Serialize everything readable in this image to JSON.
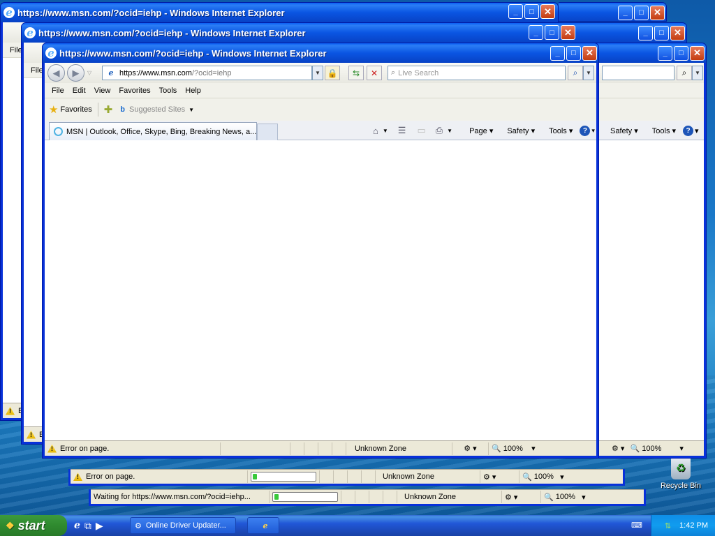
{
  "windows": [
    {
      "title": "https://www.msn.com/?ocid=iehp - Windows Internet Explorer"
    },
    {
      "title": "https://www.msn.com/?ocid=iehp - Windows Internet Explorer"
    },
    {
      "title": "https://www.msn.com/?ocid=iehp - Windows Internet Explorer"
    }
  ],
  "front": {
    "address_scheme": "https://",
    "address_host": "www.msn.com",
    "address_path": "/?ocid=iehp",
    "search_placeholder": "Live Search",
    "menu": [
      "File",
      "Edit",
      "View",
      "Favorites",
      "Tools",
      "Help"
    ],
    "favorites_label": "Favorites",
    "suggested_sites": "Suggested Sites",
    "tab_title": "MSN | Outlook, Office, Skype, Bing, Breaking News, a...",
    "commands": {
      "page": "Page",
      "safety": "Safety",
      "tools": "Tools"
    },
    "status_text": "Error on page.",
    "zone": "Unknown Zone",
    "zoom": "100%"
  },
  "back_windows": {
    "partial_menu": "File",
    "commands": {
      "safety": "Safety",
      "tools": "Tools"
    },
    "zoom": "100%",
    "partial_status": "E"
  },
  "status_bar_2": {
    "text": "Error on page.",
    "zone": "Unknown Zone",
    "zoom": "100%",
    "progress": 0.05
  },
  "status_bar_3": {
    "text": "Waiting for https://www.msn.com/?ocid=iehp...",
    "zone": "Unknown Zone",
    "zoom": "100%",
    "progress": 0.05
  },
  "taskbar": {
    "start_label": "start",
    "task_label": "Online Driver Updater...",
    "clock": "1:42 PM"
  },
  "desktop": {
    "recycle_bin": "Recycle Bin"
  }
}
